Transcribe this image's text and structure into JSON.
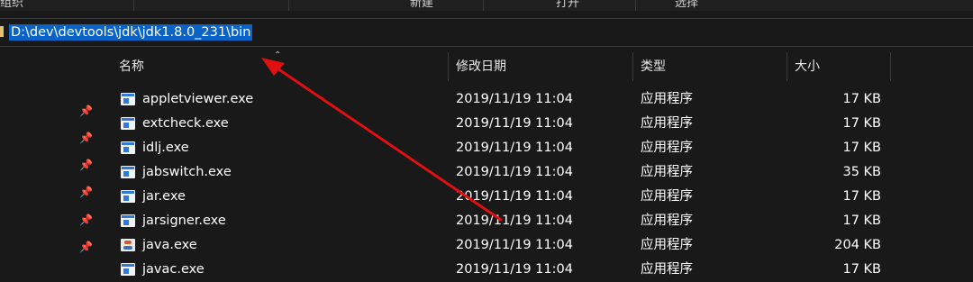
{
  "ribbon": {
    "groups": [
      "组织",
      "新建",
      "打开",
      "选择"
    ]
  },
  "address": {
    "path": "D:\\dev\\devtools\\jdk\\jdk1.8.0_231\\bin"
  },
  "columns": {
    "name": "名称",
    "date": "修改日期",
    "type": "类型",
    "size": "大小"
  },
  "files": [
    {
      "name": "appletviewer.exe",
      "date": "2019/11/19 11:04",
      "type": "应用程序",
      "size": "17 KB",
      "icon": "exe-icon"
    },
    {
      "name": "extcheck.exe",
      "date": "2019/11/19 11:04",
      "type": "应用程序",
      "size": "17 KB",
      "icon": "exe-icon"
    },
    {
      "name": "idlj.exe",
      "date": "2019/11/19 11:04",
      "type": "应用程序",
      "size": "17 KB",
      "icon": "exe-icon"
    },
    {
      "name": "jabswitch.exe",
      "date": "2019/11/19 11:04",
      "type": "应用程序",
      "size": "35 KB",
      "icon": "exe-icon"
    },
    {
      "name": "jar.exe",
      "date": "2019/11/19 11:04",
      "type": "应用程序",
      "size": "17 KB",
      "icon": "exe-icon"
    },
    {
      "name": "jarsigner.exe",
      "date": "2019/11/19 11:04",
      "type": "应用程序",
      "size": "17 KB",
      "icon": "exe-icon"
    },
    {
      "name": "java.exe",
      "date": "2019/11/19 11:04",
      "type": "应用程序",
      "size": "204 KB",
      "icon": "java-icon"
    },
    {
      "name": "javac.exe",
      "date": "2019/11/19 11:04",
      "type": "应用程序",
      "size": "17 KB",
      "icon": "exe-icon"
    }
  ],
  "colors": {
    "background": "#191919",
    "selection": "#0a64c8",
    "annotation_arrow": "#e01010"
  }
}
